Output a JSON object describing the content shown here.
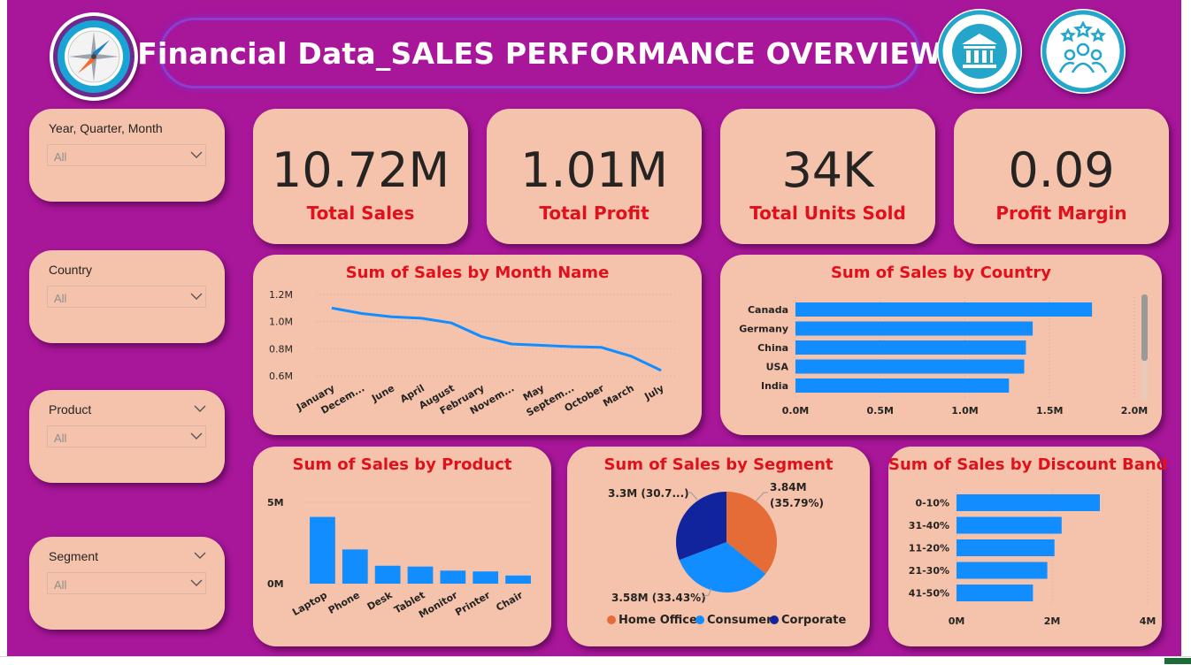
{
  "header": {
    "title": "Financial Data_SALES PERFORMANCE OVERVIEW",
    "logo_icon": "compass-icon",
    "icons": [
      "bank-icon",
      "customer-rating-icon"
    ]
  },
  "colors": {
    "background": "#a8169a",
    "card": "#f5c3ab",
    "title_red": "#e0101d",
    "bar_blue": "#118dff",
    "home_office": "#e66c37",
    "consumer": "#118dff",
    "corporate": "#12239e"
  },
  "slicers": [
    {
      "label": "Year, Quarter, Month",
      "value": "All"
    },
    {
      "label": "Country",
      "value": "All"
    },
    {
      "label": "Product",
      "value": "All"
    },
    {
      "label": "Segment",
      "value": "All"
    }
  ],
  "kpis": [
    {
      "value": "10.72M",
      "label": "Total Sales"
    },
    {
      "value": "1.01M",
      "label": "Total Profit"
    },
    {
      "value": "34K",
      "label": "Total Units Sold"
    },
    {
      "value": "0.09",
      "label": "Profit Margin"
    }
  ],
  "chart_data": [
    {
      "id": "month",
      "type": "line",
      "title": "Sum of Sales by Month Name",
      "categories": [
        "January",
        "Decem...",
        "June",
        "April",
        "August",
        "February",
        "Novem...",
        "May",
        "Septem...",
        "October",
        "March",
        "July"
      ],
      "values": [
        1.1,
        1.06,
        1.035,
        1.025,
        0.99,
        0.89,
        0.835,
        0.825,
        0.815,
        0.81,
        0.745,
        0.64
      ],
      "y_ticks": [
        "1.2M",
        "1.0M",
        "0.8M",
        "0.6M"
      ],
      "ylim": [
        0.6,
        1.2
      ]
    },
    {
      "id": "country",
      "type": "bar",
      "orientation": "horizontal",
      "title": "Sum of Sales by Country",
      "categories": [
        "Canada",
        "Germany",
        "China",
        "USA",
        "India"
      ],
      "values": [
        1.75,
        1.4,
        1.36,
        1.35,
        1.26
      ],
      "x_ticks": [
        "0.0M",
        "0.5M",
        "1.0M",
        "1.5M",
        "2.0M"
      ],
      "xlim": [
        0,
        2.0
      ]
    },
    {
      "id": "product",
      "type": "bar",
      "orientation": "vertical",
      "title": "Sum of Sales by Product",
      "categories": [
        "Laptop",
        "Phone",
        "Desk",
        "Tablet",
        "Monitor",
        "Printer",
        "Chair"
      ],
      "values": [
        4.1,
        2.1,
        1.1,
        1.05,
        0.8,
        0.75,
        0.5
      ],
      "y_ticks": [
        "5M",
        "0M"
      ],
      "ylim": [
        0,
        5
      ]
    },
    {
      "id": "segment",
      "type": "pie",
      "title": "Sum of Sales by Segment",
      "slices": [
        {
          "name": "Home Office",
          "value": 3.84,
          "percent": 35.79,
          "label1": "3.84M",
          "label2": "(35.79%)"
        },
        {
          "name": "Consumer",
          "value": 3.58,
          "percent": 33.43,
          "label1": "3.58M (33.43%)",
          "label2": ""
        },
        {
          "name": "Corporate",
          "value": 3.3,
          "percent": 30.78,
          "label1": "3.3M (30.7...)",
          "label2": ""
        }
      ],
      "legend": [
        "Home Office",
        "Consumer",
        "Corporate"
      ]
    },
    {
      "id": "discount",
      "type": "bar",
      "orientation": "horizontal",
      "title": "Sum of Sales by Discount Band",
      "categories": [
        "0-10%",
        "31-40%",
        "11-20%",
        "21-30%",
        "41-50%"
      ],
      "values": [
        3.0,
        2.2,
        2.05,
        1.9,
        1.6
      ],
      "x_ticks": [
        "0M",
        "2M",
        "4M"
      ],
      "xlim": [
        0,
        4
      ]
    }
  ]
}
